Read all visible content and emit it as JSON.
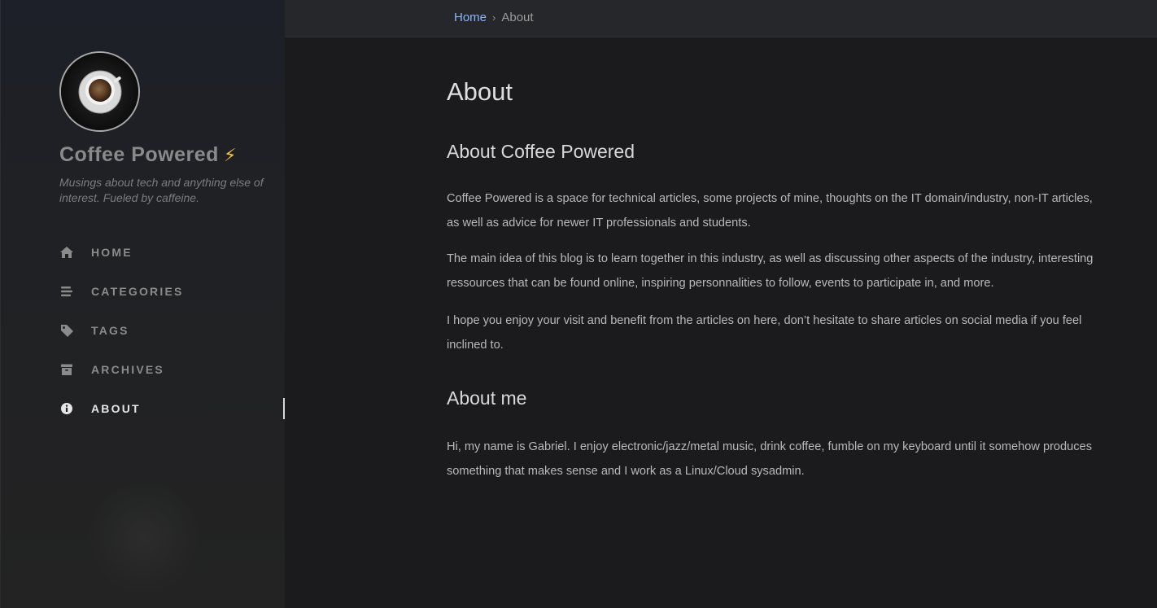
{
  "sidebar": {
    "site_title": "Coffee Powered",
    "title_emoji": "⚡",
    "tagline": "Musings about tech and anything else of interest. Fueled by caffeine.",
    "nav": [
      {
        "label": "HOME",
        "icon": "home-icon",
        "active": false
      },
      {
        "label": "CATEGORIES",
        "icon": "stream-icon",
        "active": false
      },
      {
        "label": "TAGS",
        "icon": "tag-icon",
        "active": false
      },
      {
        "label": "ARCHIVES",
        "icon": "archive-icon",
        "active": false
      },
      {
        "label": "ABOUT",
        "icon": "info-circle-icon",
        "active": true
      }
    ]
  },
  "breadcrumb": {
    "home": "Home",
    "separator": "›",
    "current": "About"
  },
  "main": {
    "title": "About",
    "sections": [
      {
        "heading": "About Coffee Powered",
        "paragraphs": [
          "Coffee Powered is a space for technical articles, some projects of mine, thoughts on the IT domain/industry, non-IT articles, as well as advice for newer IT professionals and students.",
          "The main idea of this blog is to learn together in this industry, as well as discussing other aspects of the industry, interesting ressources that can be found online, inspiring personnalities to follow, events to participate in, and more.",
          "I hope you enjoy your visit and benefit from the articles on here, don’t hesitate to share articles on social media if you feel inclined to."
        ]
      },
      {
        "heading": "About me",
        "paragraphs": [
          "Hi, my name is Gabriel. I enjoy electronic/jazz/metal music, drink coffee, fumble on my keyboard until it somehow produces something that makes sense and I work as a Linux/Cloud sysadmin."
        ]
      }
    ]
  },
  "colors": {
    "link": "#8ab4f8",
    "bolt": "#f4c430",
    "background": "#1b1b1e",
    "sidebar": "#202124"
  }
}
